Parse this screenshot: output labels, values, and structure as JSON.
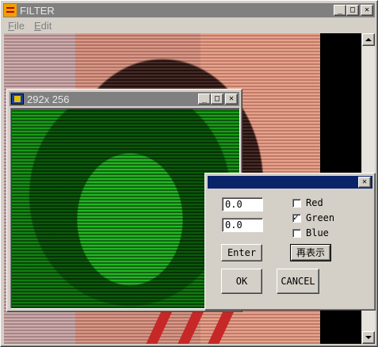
{
  "main_window": {
    "title": "FILTER",
    "menu": [
      {
        "key": "F",
        "rest": "ile"
      },
      {
        "key": "E",
        "rest": "dit"
      }
    ],
    "controls": {
      "minimize": "_",
      "maximize": "□",
      "close": "✕"
    }
  },
  "child_window": {
    "title": "292x 256",
    "controls": {
      "minimize": "_",
      "maximize": "□",
      "close": "✕"
    }
  },
  "dialog": {
    "close": "✕",
    "field1_value": "0.0",
    "field2_value": "0.0",
    "checkboxes": [
      {
        "label": "Red",
        "checked": false
      },
      {
        "label": "Green",
        "checked": true
      },
      {
        "label": "Blue",
        "checked": false
      }
    ],
    "enter_button": "Enter",
    "redisplay_button": "再表示",
    "ok_button": "OK",
    "cancel_button": "CANCEL"
  },
  "colors": {
    "dialog_titlebar": "#0a246a",
    "inactive_titlebar": "#808080",
    "green_filter": "#1aa01a"
  },
  "icons": {
    "app": "filter-app-icon",
    "child": "movie-film-icon"
  }
}
